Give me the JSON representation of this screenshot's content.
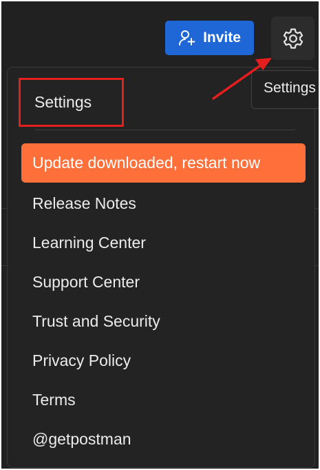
{
  "header": {
    "invite_label": "Invite",
    "settings_icon": "gear-icon"
  },
  "tooltip": {
    "label": "Settings"
  },
  "menu": {
    "settings_label": "Settings",
    "update_label": "Update downloaded, restart now",
    "items": [
      {
        "label": "Release Notes"
      },
      {
        "label": "Learning Center"
      },
      {
        "label": "Support Center"
      },
      {
        "label": "Trust and Security"
      },
      {
        "label": "Privacy Policy"
      },
      {
        "label": "Terms"
      },
      {
        "label": "@getpostman"
      }
    ]
  },
  "colors": {
    "background": "#212121",
    "invite": "#1f66d7",
    "update": "#ff6f3a",
    "highlight": "#e61e1e"
  }
}
